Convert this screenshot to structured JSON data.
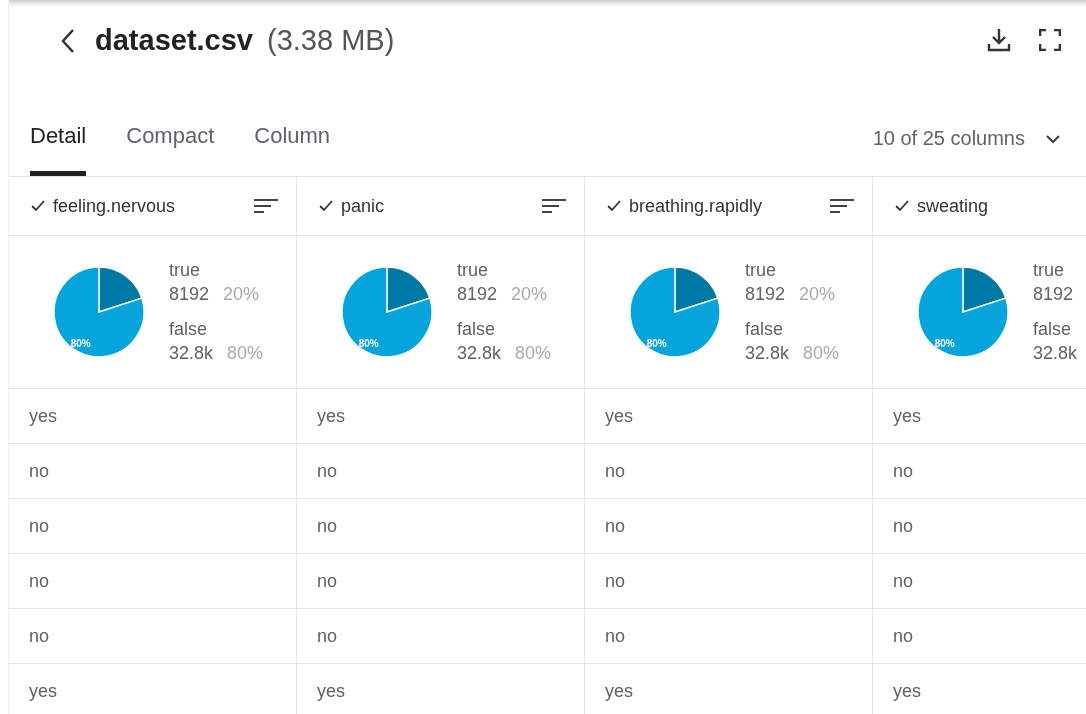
{
  "header": {
    "title": "dataset.csv",
    "size": "(3.38 MB)"
  },
  "tabs": [
    {
      "label": "Detail",
      "selected": true
    },
    {
      "label": "Compact",
      "selected": false
    },
    {
      "label": "Column",
      "selected": false
    }
  ],
  "column_picker": {
    "label": "10 of 25 columns"
  },
  "table": {
    "columns": [
      {
        "name": "feeling.nervous",
        "checked": true,
        "sort_icon": true,
        "stats": [
          {
            "count": "8192",
            "pct": "20%"
          },
          {
            "count": "32.8k",
            "pct": "80%"
          }
        ],
        "chart_data": {
          "type": "pie",
          "categories": [
            "true",
            "false"
          ],
          "values": [
            20,
            80
          ],
          "value_labels": [
            null,
            "80%"
          ]
        }
      },
      {
        "name": "panic",
        "checked": true,
        "sort_icon": true,
        "stats": [
          {
            "count": "8192",
            "pct": "20%"
          },
          {
            "count": "32.8k",
            "pct": "80%"
          }
        ],
        "chart_data": {
          "type": "pie",
          "categories": [
            "true",
            "false"
          ],
          "values": [
            20,
            80
          ],
          "value_labels": [
            null,
            "80%"
          ]
        }
      },
      {
        "name": "breathing.rapidly",
        "checked": true,
        "sort_icon": true,
        "stats": [
          {
            "count": "8192",
            "pct": "20%"
          },
          {
            "count": "32.8k",
            "pct": "80%"
          }
        ],
        "chart_data": {
          "type": "pie",
          "categories": [
            "true",
            "false"
          ],
          "values": [
            20,
            80
          ],
          "value_labels": [
            null,
            "80%"
          ]
        }
      },
      {
        "name": "sweating",
        "checked": true,
        "sort_icon": false,
        "stats": [
          {
            "count": "8192"
          },
          {
            "count": "32.8k"
          }
        ],
        "chart_data": {
          "type": "pie",
          "categories": [
            "true",
            "false"
          ],
          "values": [
            20,
            80
          ],
          "value_labels": [
            null,
            "80%"
          ]
        }
      }
    ],
    "rows": [
      [
        "yes",
        "yes",
        "yes",
        "yes"
      ],
      [
        "no",
        "no",
        "no",
        "no"
      ],
      [
        "no",
        "no",
        "no",
        "no"
      ],
      [
        "no",
        "no",
        "no",
        "no"
      ],
      [
        "no",
        "no",
        "no",
        "no"
      ],
      [
        "yes",
        "yes",
        "yes",
        "yes"
      ]
    ]
  }
}
